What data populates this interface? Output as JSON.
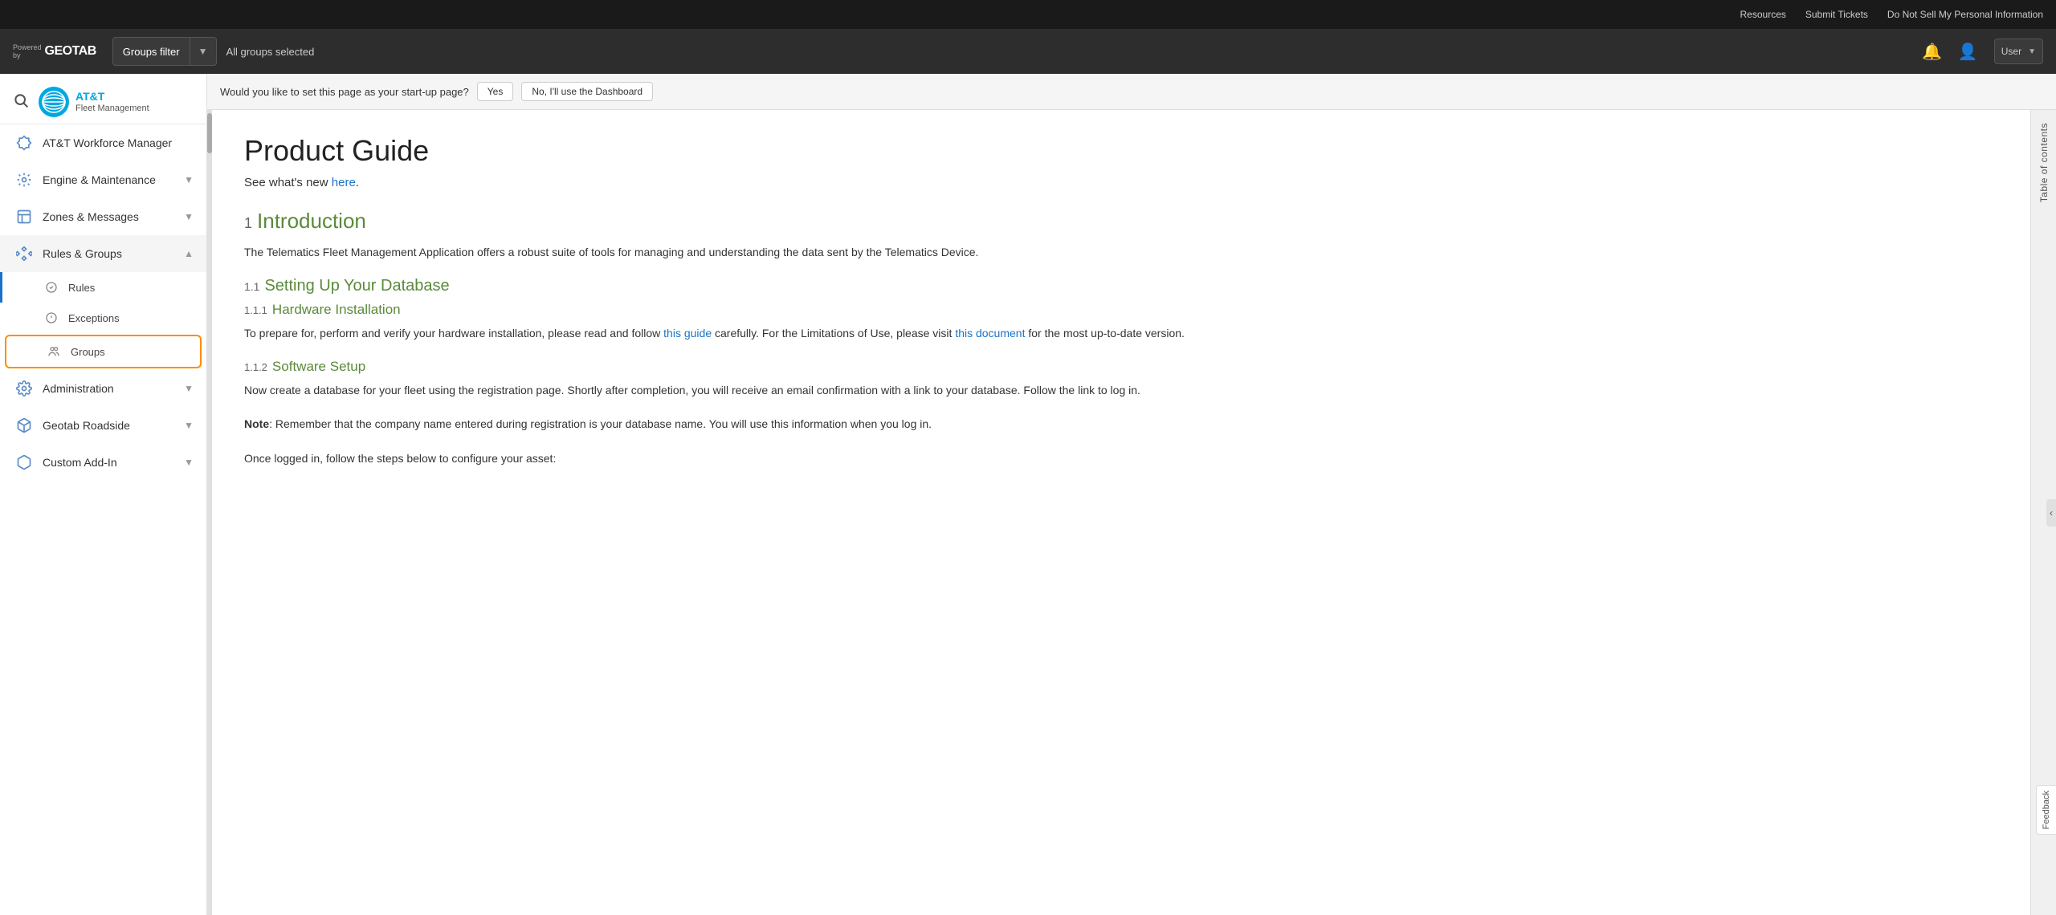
{
  "topbar": {
    "resources_label": "Resources",
    "submit_tickets_label": "Submit Tickets",
    "do_not_sell_label": "Do Not Sell My Personal Information"
  },
  "filterbar": {
    "groups_filter_label": "Groups filter",
    "all_groups_label": "All groups selected",
    "dropdown_arrow": "▼"
  },
  "sidebar": {
    "brand_name": "AT&T",
    "brand_sub": "Fleet Management",
    "search_icon": "🔍",
    "nav_items": [
      {
        "id": "workforce",
        "label": "AT&T Workforce Manager",
        "icon": "puzzle",
        "has_chevron": false
      },
      {
        "id": "engine",
        "label": "Engine & Maintenance",
        "icon": "gear",
        "has_chevron": true
      },
      {
        "id": "zones",
        "label": "Zones & Messages",
        "icon": "edit",
        "has_chevron": true
      },
      {
        "id": "rules",
        "label": "Rules & Groups",
        "icon": "shield",
        "has_chevron": true,
        "expanded": true
      },
      {
        "id": "administration",
        "label": "Administration",
        "icon": "gear2",
        "has_chevron": true
      },
      {
        "id": "geotab",
        "label": "Geotab Roadside",
        "icon": "puzzle2",
        "has_chevron": true
      },
      {
        "id": "custom",
        "label": "Custom Add-In",
        "icon": "puzzle3",
        "has_chevron": true
      }
    ],
    "sub_items": [
      {
        "id": "rules",
        "label": "Rules",
        "parent": "rules"
      },
      {
        "id": "exceptions",
        "label": "Exceptions",
        "parent": "rules"
      },
      {
        "id": "groups",
        "label": "Groups",
        "parent": "rules",
        "active": true
      }
    ]
  },
  "startup_prompt": {
    "question": "Would you like to set this page as your start-up page?",
    "yes_label": "Yes",
    "no_label": "No, I'll use the Dashboard"
  },
  "content": {
    "page_title": "Product Guide",
    "subtitle_text": "See what's new ",
    "subtitle_link": "here",
    "subtitle_end": ".",
    "sections": [
      {
        "num": "1",
        "title": "Introduction",
        "body": "The Telematics Fleet Management Application offers a robust suite of tools for managing and understanding the data sent by the Telematics Device."
      },
      {
        "num": "1.1",
        "title": "Setting Up Your Database",
        "level": 2
      },
      {
        "num": "1.1.1",
        "title": "Hardware Installation",
        "level": 3,
        "body": "To prepare for, perform and verify your hardware installation, please read and follow ",
        "link1_text": "this guide",
        "body2": " carefully. For the Limitations of Use, please visit ",
        "link2_text": "this document",
        "body3": " for the most up-to-date version."
      },
      {
        "num": "1.1.2",
        "title": "Software Setup",
        "level": 3,
        "body": "Now create a database for your fleet using the registration page. Shortly after completion, you will receive an email confirmation with a link to your database. Follow the link to log in.",
        "note": "Note: Remember that the company name entered during registration is your database name. You will use this information when you log in.",
        "body2": "Once logged in, follow the steps below to configure your asset:"
      }
    ]
  },
  "toc": {
    "label": "Table of contents",
    "feedback_label": "Feedback"
  }
}
